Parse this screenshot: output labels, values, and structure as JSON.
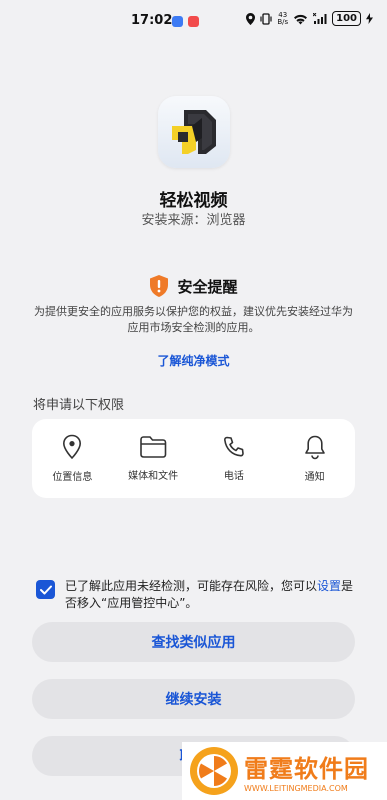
{
  "status_bar": {
    "time": "17:02",
    "net_speed_value": "43",
    "net_speed_unit": "B/s",
    "battery": "100"
  },
  "app": {
    "name": "轻松视频",
    "source": "安装来源：浏览器"
  },
  "warning": {
    "icon": "shield-alert-icon",
    "title": "安全提醒",
    "description": "为提供更安全的应用服务以保护您的权益，建议优先安装经过华为应用市场安全检测的应用。",
    "link": "了解纯净模式",
    "accent_color": "#ef7a28"
  },
  "permissions": {
    "heading": "将申请以下权限",
    "items": [
      {
        "icon": "location-icon",
        "label": "位置信息"
      },
      {
        "icon": "folder-icon",
        "label": "媒体和文件"
      },
      {
        "icon": "phone-icon",
        "label": "电话"
      },
      {
        "icon": "bell-icon",
        "label": "通知"
      }
    ]
  },
  "consent": {
    "checked": true,
    "text_before": "已了解此应用未经检测，可能存在风险，您可以",
    "link": "设置",
    "text_after": "是否移入“应用管控中心”。"
  },
  "buttons": {
    "find_similar": "查找类似应用",
    "continue_install": "继续安装",
    "cancel": "取消"
  },
  "watermark": {
    "title": "雷霆软件园",
    "url": "WWW.LEITINGMEDIA.COM"
  },
  "colors": {
    "accent": "#1a56d6",
    "background": "#f1f1f3",
    "watermark": "#f07c1a"
  }
}
